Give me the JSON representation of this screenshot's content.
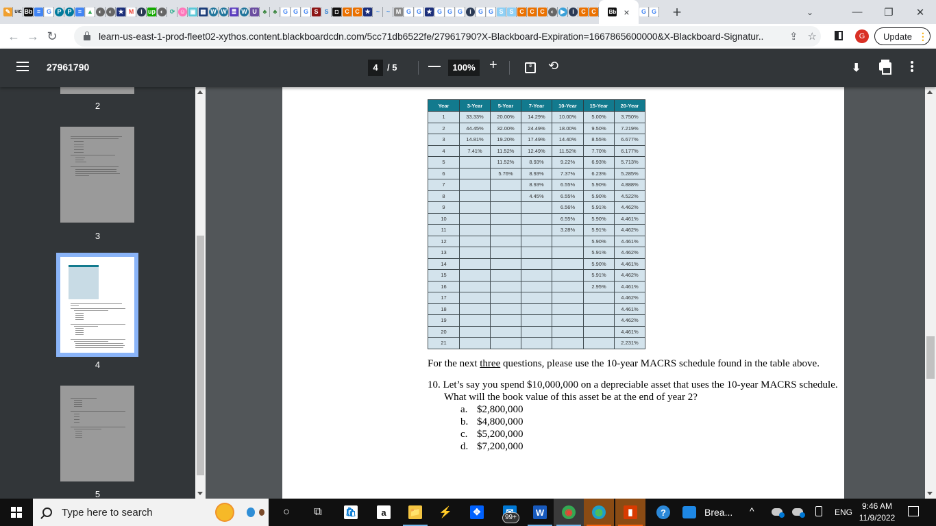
{
  "browser": {
    "favicon_tabs": [
      {
        "name": "pencil",
        "bg": "#f0a030",
        "glyph": "✎"
      },
      {
        "name": "uic",
        "bg": "#dee1e6",
        "glyph": "UIC",
        "fg": "#000"
      },
      {
        "name": "blackboard",
        "bg": "#111",
        "glyph": "Bb"
      },
      {
        "name": "google-docs",
        "bg": "#4285f4",
        "glyph": "≡"
      },
      {
        "name": "google",
        "bg": "#fff",
        "glyph": "G",
        "fg": "#4285f4"
      },
      {
        "name": "pearson",
        "bg": "#007a9c",
        "glyph": "P",
        "round": true
      },
      {
        "name": "pearson",
        "bg": "#007a9c",
        "glyph": "P",
        "round": true
      },
      {
        "name": "google-docs",
        "bg": "#4285f4",
        "glyph": "≡"
      },
      {
        "name": "google-drive",
        "bg": "#fff",
        "glyph": "▲",
        "fg": "#34a853"
      },
      {
        "name": "globe",
        "bg": "#666",
        "glyph": "◐",
        "round": true
      },
      {
        "name": "globe",
        "bg": "#666",
        "glyph": "◐",
        "round": true
      },
      {
        "name": "shield-star",
        "bg": "#1c2f7a",
        "glyph": "★"
      },
      {
        "name": "gmail",
        "bg": "#fff",
        "glyph": "M",
        "fg": "#ea4335"
      },
      {
        "name": "info",
        "bg": "#2b3a55",
        "glyph": "i",
        "round": true
      },
      {
        "name": "upwork",
        "bg": "#14a800",
        "glyph": "up"
      },
      {
        "name": "globe",
        "bg": "#666",
        "glyph": "◐",
        "round": true
      },
      {
        "name": "sync",
        "bg": "#dee1e6",
        "glyph": "⟳",
        "fg": "#2a8"
      },
      {
        "name": "avatar",
        "bg": "#f7b",
        "glyph": "☺",
        "round": true
      },
      {
        "name": "app",
        "bg": "#5bc8d8",
        "glyph": "▣"
      },
      {
        "name": "grid",
        "bg": "#1c3d7a",
        "glyph": "▦"
      },
      {
        "name": "wordpress",
        "bg": "#21759b",
        "glyph": "W",
        "round": true
      },
      {
        "name": "wordpress",
        "bg": "#21759b",
        "glyph": "W",
        "round": true
      },
      {
        "name": "list",
        "bg": "#5b3dbe",
        "glyph": "≣"
      },
      {
        "name": "wordpress",
        "bg": "#21759b",
        "glyph": "W",
        "round": true
      },
      {
        "name": "shield-u",
        "bg": "#6b4ea0",
        "glyph": "U"
      },
      {
        "name": "tree",
        "bg": "#dee1e6",
        "glyph": "♣",
        "fg": "#2a7d2e"
      },
      {
        "name": "tree",
        "bg": "#dee1e6",
        "glyph": "♣",
        "fg": "#2a7d2e"
      },
      {
        "name": "google",
        "bg": "#fff",
        "glyph": "G",
        "fg": "#4285f4"
      },
      {
        "name": "google",
        "bg": "#fff",
        "glyph": "G",
        "fg": "#4285f4"
      },
      {
        "name": "google",
        "bg": "#fff",
        "glyph": "G",
        "fg": "#4285f4"
      },
      {
        "name": "stanford",
        "bg": "#8c1515",
        "glyph": "S"
      },
      {
        "name": "s-logo",
        "bg": "#dee1e6",
        "glyph": "S",
        "fg": "#2d7fd3"
      },
      {
        "name": "dark-square",
        "bg": "#111",
        "glyph": "◘"
      },
      {
        "name": "chegg",
        "bg": "#eb7100",
        "glyph": "C"
      },
      {
        "name": "chegg",
        "bg": "#eb7100",
        "glyph": "C"
      },
      {
        "name": "shield-star",
        "bg": "#1c2f7a",
        "glyph": "★"
      },
      {
        "name": "dash",
        "bg": "#dee1e6",
        "glyph": "~",
        "fg": "#4a90e2"
      },
      {
        "name": "dash",
        "bg": "#dee1e6",
        "glyph": "~",
        "fg": "#4a90e2"
      },
      {
        "name": "m-box",
        "bg": "#888",
        "glyph": "M"
      },
      {
        "name": "google",
        "bg": "#fff",
        "glyph": "G",
        "fg": "#4285f4"
      },
      {
        "name": "google",
        "bg": "#fff",
        "glyph": "G",
        "fg": "#4285f4"
      },
      {
        "name": "shield-star",
        "bg": "#1c2f7a",
        "glyph": "★"
      },
      {
        "name": "google",
        "bg": "#fff",
        "glyph": "G",
        "fg": "#4285f4"
      },
      {
        "name": "google",
        "bg": "#fff",
        "glyph": "G",
        "fg": "#4285f4"
      },
      {
        "name": "google",
        "bg": "#fff",
        "glyph": "G",
        "fg": "#4285f4"
      },
      {
        "name": "info",
        "bg": "#2b3a55",
        "glyph": "i",
        "round": true
      },
      {
        "name": "google",
        "bg": "#fff",
        "glyph": "G",
        "fg": "#4285f4"
      },
      {
        "name": "google",
        "bg": "#fff",
        "glyph": "G",
        "fg": "#4285f4"
      },
      {
        "name": "s-light",
        "bg": "#8fd0f5",
        "glyph": "S"
      },
      {
        "name": "s-light",
        "bg": "#8fd0f5",
        "glyph": "S"
      },
      {
        "name": "chegg",
        "bg": "#eb7100",
        "glyph": "C"
      },
      {
        "name": "chegg",
        "bg": "#eb7100",
        "glyph": "C"
      },
      {
        "name": "chegg",
        "bg": "#eb7100",
        "glyph": "C"
      },
      {
        "name": "globe",
        "bg": "#666",
        "glyph": "◐",
        "round": true
      },
      {
        "name": "play",
        "bg": "#3aa0d8",
        "glyph": "▶",
        "round": true
      },
      {
        "name": "info",
        "bg": "#2b3a55",
        "glyph": "i",
        "round": true
      },
      {
        "name": "chegg",
        "bg": "#eb7100",
        "glyph": "C"
      },
      {
        "name": "chegg",
        "bg": "#eb7100",
        "glyph": "C"
      }
    ],
    "active_tab": {
      "favicon": "Bb",
      "close": "×"
    },
    "after_tabs": [
      {
        "name": "google",
        "bg": "#fff",
        "glyph": "G",
        "fg": "#4285f4"
      },
      {
        "name": "google",
        "bg": "#fff",
        "glyph": "G",
        "fg": "#4285f4"
      }
    ],
    "new_tab": "+",
    "window_controls": {
      "tab_search": "⌄",
      "minimize": "—",
      "restore": "❐",
      "close": "✕"
    },
    "nav": {
      "back": "←",
      "forward": "→",
      "reload": "↻"
    },
    "url": "learn-us-east-1-prod-fleet02-xythos.content.blackboardcdn.com/5cc71db6522fe/27961790?X-Blackboard-Expiration=1667865600000&X-Blackboard-Signatur...",
    "share_icon": "⇪",
    "star_icon": "☆",
    "profile_initial": "G",
    "update_label": "Update",
    "update_menu": "⋮"
  },
  "pdf_toolbar": {
    "title": "27961790",
    "current_page": "4",
    "page_total": "/ 5",
    "zoom_out": "—",
    "zoom": "100%",
    "zoom_in": "+",
    "rotate": "⟲",
    "download": "⬇"
  },
  "sidebar": {
    "pages": [
      {
        "number": "2"
      },
      {
        "number": "3"
      },
      {
        "number": "4",
        "active": true
      },
      {
        "number": "5"
      }
    ]
  },
  "document": {
    "table": {
      "headers": [
        "Year",
        "3-Year",
        "5-Year",
        "7-Year",
        "10-Year",
        "15-Year",
        "20-Year"
      ],
      "rows": [
        [
          "1",
          "33.33%",
          "20.00%",
          "14.29%",
          "10.00%",
          "5.00%",
          "3.750%"
        ],
        [
          "2",
          "44.45%",
          "32.00%",
          "24.49%",
          "18.00%",
          "9.50%",
          "7.219%"
        ],
        [
          "3",
          "14.81%",
          "19.20%",
          "17.49%",
          "14.40%",
          "8.55%",
          "6.677%"
        ],
        [
          "4",
          "7.41%",
          "11.52%",
          "12.49%",
          "11.52%",
          "7.70%",
          "6.177%"
        ],
        [
          "5",
          "",
          "11.52%",
          "8.93%",
          "9.22%",
          "6.93%",
          "5.713%"
        ],
        [
          "6",
          "",
          "5.76%",
          "8.93%",
          "7.37%",
          "6.23%",
          "5.285%"
        ],
        [
          "7",
          "",
          "",
          "8.93%",
          "6.55%",
          "5.90%",
          "4.888%"
        ],
        [
          "8",
          "",
          "",
          "4.45%",
          "6.55%",
          "5.90%",
          "4.522%"
        ],
        [
          "9",
          "",
          "",
          "",
          "6.56%",
          "5.91%",
          "4.462%"
        ],
        [
          "10",
          "",
          "",
          "",
          "6.55%",
          "5.90%",
          "4.461%"
        ],
        [
          "11",
          "",
          "",
          "",
          "3.28%",
          "5.91%",
          "4.462%"
        ],
        [
          "12",
          "",
          "",
          "",
          "",
          "5.90%",
          "4.461%"
        ],
        [
          "13",
          "",
          "",
          "",
          "",
          "5.91%",
          "4.462%"
        ],
        [
          "14",
          "",
          "",
          "",
          "",
          "5.90%",
          "4.461%"
        ],
        [
          "15",
          "",
          "",
          "",
          "",
          "5.91%",
          "4.462%"
        ],
        [
          "16",
          "",
          "",
          "",
          "",
          "2.95%",
          "4.461%"
        ],
        [
          "17",
          "",
          "",
          "",
          "",
          "",
          "4.462%"
        ],
        [
          "18",
          "",
          "",
          "",
          "",
          "",
          "4.461%"
        ],
        [
          "19",
          "",
          "",
          "",
          "",
          "",
          "4.462%"
        ],
        [
          "20",
          "",
          "",
          "",
          "",
          "",
          "4.461%"
        ],
        [
          "21",
          "",
          "",
          "",
          "",
          "",
          "2.231%"
        ]
      ]
    },
    "intro": {
      "before": "For the next ",
      "underlined": "three",
      "after": " questions, please use the 10-year MACRS schedule found in the table above."
    },
    "question": {
      "number": "10.",
      "text": "Let’s say you spend $10,000,000 on a depreciable asset that uses the 10-year MACRS schedule. What will the book value of this asset be at the end of year 2?",
      "options": [
        {
          "letter": "a.",
          "text": "$2,800,000"
        },
        {
          "letter": "b.",
          "text": "$4,800,000"
        },
        {
          "letter": "c.",
          "text": "$5,200,000"
        },
        {
          "letter": "d.",
          "text": "$7,200,000"
        }
      ]
    }
  },
  "taskbar": {
    "search_placeholder": "Type here to search",
    "apps": [
      {
        "name": "cortana",
        "glyph": "○"
      },
      {
        "name": "task-view",
        "glyph": "⧉"
      },
      {
        "name": "microsoft-store",
        "glyph": "🛍"
      },
      {
        "name": "amazon",
        "glyph": "a"
      },
      {
        "name": "file-explorer",
        "glyph": "📁"
      },
      {
        "name": "app-bolt",
        "glyph": "⚡"
      },
      {
        "name": "dropbox",
        "glyph": "✥"
      },
      {
        "name": "mail",
        "glyph": "✉"
      },
      {
        "name": "word",
        "glyph": "W"
      },
      {
        "name": "chrome",
        "glyph": "◉"
      },
      {
        "name": "edge",
        "glyph": "◍"
      },
      {
        "name": "office",
        "glyph": "▮"
      },
      {
        "name": "help",
        "glyph": "?"
      }
    ],
    "mail_badge": "99+",
    "news": "Brea...",
    "tray_chevron": "^",
    "language": "ENG",
    "time": "9:46 AM",
    "date": "11/9/2022"
  }
}
